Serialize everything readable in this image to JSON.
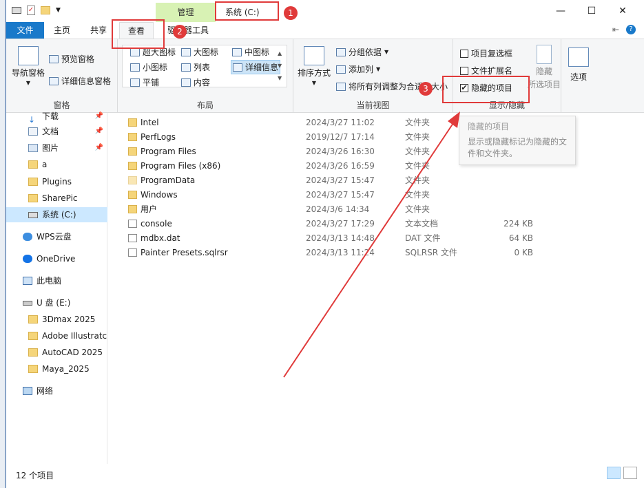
{
  "window": {
    "title": "系统 (C:)",
    "context_tab": "管理",
    "controls": [
      "—",
      "☐",
      "✕"
    ]
  },
  "tabs": [
    {
      "label": "文件"
    },
    {
      "label": "主页"
    },
    {
      "label": "共享"
    },
    {
      "label": "查看"
    },
    {
      "label": "驱动器工具"
    }
  ],
  "ribbon": {
    "pane_group": {
      "label": "窗格",
      "nav_pane": "导航窗格",
      "preview_pane": "预览窗格",
      "details_pane": "详细信息窗格"
    },
    "layout_group": {
      "label": "布局",
      "items": [
        "超大图标",
        "大图标",
        "中图标",
        "小图标",
        "列表",
        "详细信息",
        "平铺",
        "内容"
      ],
      "selected": "详细信息"
    },
    "current_view_group": {
      "label": "当前视图",
      "sort": "排序方式",
      "group_by": "分组依据",
      "add_column": "添加列",
      "fit_columns": "将所有列调整为合适的大小"
    },
    "show_hide_group": {
      "label": "显示/隐藏",
      "item_checkboxes": {
        "label": "项目复选框",
        "checked": false
      },
      "file_extensions": {
        "label": "文件扩展名",
        "checked": false
      },
      "hidden_items": {
        "label": "隐藏的项目",
        "checked": true
      },
      "hide_selected_line1": "隐藏",
      "hide_selected_line2": "所选项目"
    },
    "options": {
      "label": "选项"
    }
  },
  "nav": {
    "items": [
      {
        "label": "下载",
        "pinned": true
      },
      {
        "label": "文档",
        "pinned": true
      },
      {
        "label": "图片",
        "pinned": true
      },
      {
        "label": "a"
      },
      {
        "label": "Plugins"
      },
      {
        "label": "SharePic"
      },
      {
        "label": "系统 (C:)",
        "selected": true
      },
      {
        "label": "WPS云盘"
      },
      {
        "label": "OneDrive"
      },
      {
        "label": "此电脑"
      },
      {
        "label": "U 盘 (E:)"
      },
      {
        "label": "3Dmax 2025"
      },
      {
        "label": "Adobe Illustratc"
      },
      {
        "label": "AutoCAD 2025"
      },
      {
        "label": "Maya_2025"
      },
      {
        "label": "网络"
      }
    ]
  },
  "files": [
    {
      "name": "Intel",
      "date": "2024/3/27 11:02",
      "type": "文件夹",
      "size": ""
    },
    {
      "name": "PerfLogs",
      "date": "2019/12/7 17:14",
      "type": "文件夹",
      "size": ""
    },
    {
      "name": "Program Files",
      "date": "2024/3/26 16:30",
      "type": "文件夹",
      "size": ""
    },
    {
      "name": "Program Files (x86)",
      "date": "2024/3/26 16:59",
      "type": "文件夹",
      "size": ""
    },
    {
      "name": "ProgramData",
      "date": "2024/3/27 15:47",
      "type": "文件夹",
      "size": ""
    },
    {
      "name": "Windows",
      "date": "2024/3/27 15:47",
      "type": "文件夹",
      "size": ""
    },
    {
      "name": "用户",
      "date": "2024/3/6 14:34",
      "type": "文件夹",
      "size": ""
    },
    {
      "name": "console",
      "date": "2024/3/27 17:29",
      "type": "文本文档",
      "size": "224 KB"
    },
    {
      "name": "mdbx.dat",
      "date": "2024/3/13 14:48",
      "type": "DAT 文件",
      "size": "64 KB"
    },
    {
      "name": "Painter Presets.sqlrsr",
      "date": "2024/3/13 11:24",
      "type": "SQLRSR 文件",
      "size": "0 KB"
    }
  ],
  "tooltip": {
    "title": "隐藏的项目",
    "body": "显示或隐藏标记为隐藏的文件和文件夹。"
  },
  "status": {
    "count": "12 个项目"
  },
  "annotations": {
    "badges": [
      "1",
      "2",
      "3"
    ],
    "color": "#e03a3a"
  },
  "colors": {
    "accent": "#1979ca",
    "context_tab": "#d8f2b4",
    "selection": "#cce8ff"
  }
}
